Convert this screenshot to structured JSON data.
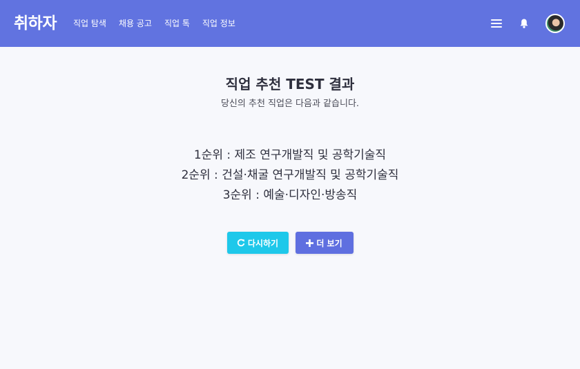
{
  "nav": {
    "brand": "취하자",
    "links": [
      "직업 탐색",
      "채용 공고",
      "직업 톡",
      "직업 정보"
    ],
    "icons": [
      "menu-icon",
      "bell-icon"
    ]
  },
  "main": {
    "title": "직업 추천 TEST 결과",
    "subtitle": "당신의 추천 직업은 다음과 같습니다.",
    "ranks": [
      "1순위 : 제조 연구개발직 및 공학기술직",
      "2순위 : 건설·채굴 연구개발직 및 공학기술직",
      "3순위 : 예술·디자인·방송직"
    ],
    "buttons": {
      "retry_label": "다시하기",
      "more_label": "더 보기"
    }
  },
  "colors": {
    "navbar": "#6173e0",
    "background": "#f7f8fc",
    "retry_button": "#1ec8ea",
    "more_button": "#5f6fe0"
  }
}
